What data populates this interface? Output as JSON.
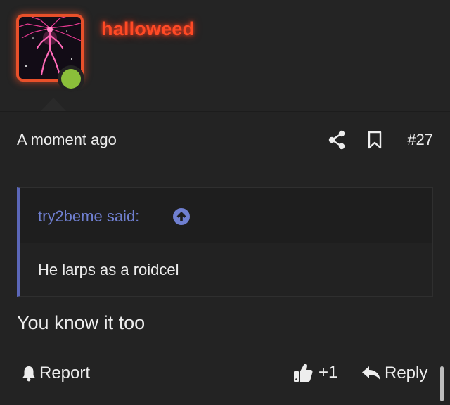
{
  "user": {
    "username": "halloweed",
    "online": true,
    "username_color": "#ff4a25",
    "avatar_border_color": "#e8502a",
    "online_color": "#8bbf3a"
  },
  "post": {
    "timestamp": "A moment ago",
    "number": "#27",
    "share_icon": "share-icon",
    "bookmark_icon": "bookmark-icon",
    "quote": {
      "author_label": "try2beme said:",
      "body": "He larps as a roidcel",
      "accent_color": "#5b67b8"
    },
    "message": "You know it too"
  },
  "actions": {
    "report_label": "Report",
    "like_count": "+1",
    "reply_label": "Reply"
  }
}
